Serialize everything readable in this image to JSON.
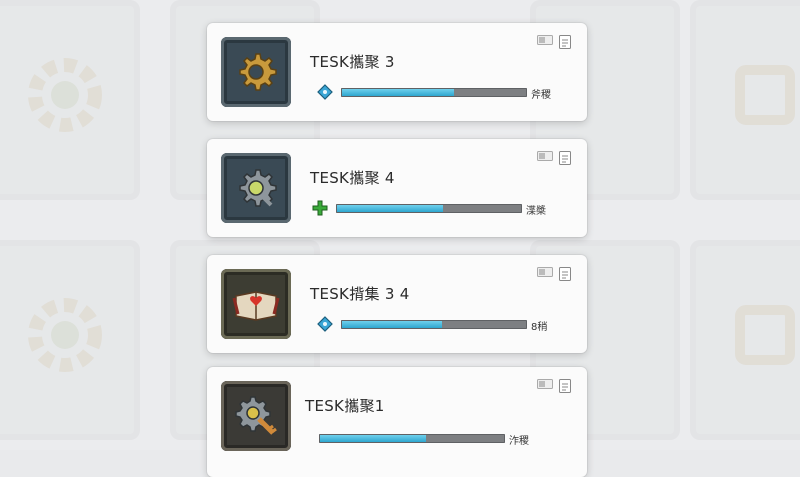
{
  "cards": [
    {
      "title": "TESK攜聚 3",
      "stat": "斧稷",
      "progress": 0.6,
      "badge": "diamond",
      "badge_color": "#3aa6d6",
      "icon": "gear-icon"
    },
    {
      "title": "TESK攜聚 4",
      "stat": "渫槳",
      "progress": 0.57,
      "badge": "plus",
      "badge_color": "#3aaa3a",
      "icon": "gear-wrench-icon"
    },
    {
      "title": "TESK揹集 3 4",
      "stat": "8稍",
      "progress": 0.54,
      "badge": "diamond",
      "badge_color": "#3aa6d6",
      "icon": "spellbook-icon"
    },
    {
      "title": "TESK攜聚1",
      "stat": "泎稷",
      "progress": 0.57,
      "badge": "none",
      "badge_color": "",
      "icon": "gear-key-icon"
    }
  ],
  "colors": {
    "bar_fill": "#2ea6cf",
    "bar_track": "#7d7f82",
    "card_bg": "#fbfbfb"
  }
}
